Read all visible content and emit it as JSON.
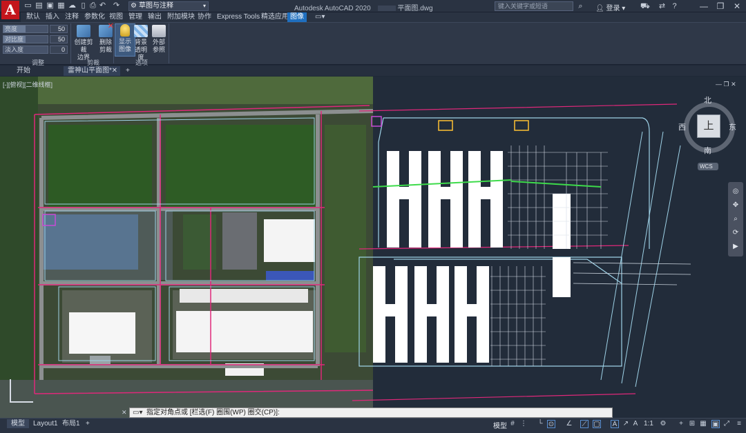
{
  "titlebar": {
    "logo": "A",
    "workspace": "草图与注释",
    "app_title": "Autodesk AutoCAD 2020",
    "file_name": "平面图.dwg",
    "search_placeholder": "键入关键字或短语",
    "login": "登录"
  },
  "ribbon": {
    "tabs": [
      "默认",
      "插入",
      "注释",
      "参数化",
      "视图",
      "管理",
      "输出",
      "附加模块",
      "协作",
      "Express Tools",
      "精选应用",
      "图像"
    ],
    "active_tab": "图像",
    "adjust": {
      "label": "调整",
      "rows": [
        {
          "name": "亮度",
          "value": "50",
          "fill": 0.5
        },
        {
          "name": "对比度",
          "value": "50",
          "fill": 0.5
        },
        {
          "name": "淡入度",
          "value": "0",
          "fill": 0.0
        }
      ]
    },
    "clip": {
      "label": "剪裁",
      "buttons": [
        {
          "line1": "创建剪裁",
          "line2": "边界"
        },
        {
          "line1": "删除",
          "line2": "剪裁"
        }
      ]
    },
    "options": {
      "label": "选项",
      "buttons": [
        {
          "line1": "显示",
          "line2": "图像"
        },
        {
          "line1": "背景",
          "line2": "透明度"
        },
        {
          "line1": "外部",
          "line2": "参照"
        }
      ]
    }
  },
  "filetabs": {
    "start": "开始",
    "current": "雷神山平面图*"
  },
  "viewport": {
    "label": "[-][俯视][二维线框]",
    "viewcube": {
      "north": "北",
      "south": "南",
      "east": "东",
      "west": "西",
      "top": "上",
      "wcs": "WCS"
    }
  },
  "command": {
    "prompt": "指定对角点或 [栏选(F) 圈围(WP) 圈交(CP)]:"
  },
  "status": {
    "layout_tabs": [
      "模型",
      "Layout1",
      "布局1"
    ],
    "active_layout": "模型",
    "model": "模型",
    "scale": "1:1"
  },
  "colors": {
    "accent": "#1f6fbf",
    "logo_red": "#c4161c",
    "road_magenta": "#e0287a",
    "cad_blue": "#9fd3e8"
  }
}
